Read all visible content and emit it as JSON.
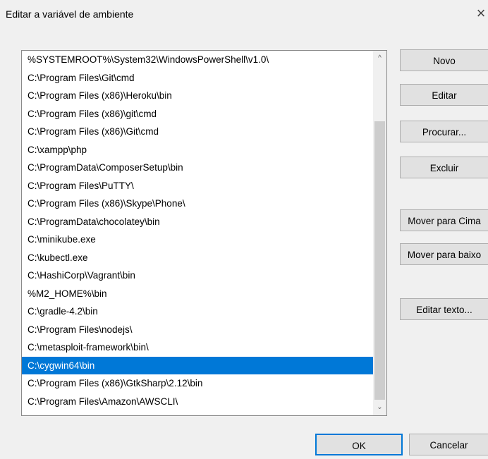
{
  "dialog": {
    "title": "Editar a variável de ambiente",
    "close_glyph": "×"
  },
  "path_list": {
    "selected_index": 18,
    "items": [
      "%SYSTEMROOT%\\System32\\WindowsPowerShell\\v1.0\\",
      "C:\\Program Files\\Git\\cmd",
      "C:\\Program Files (x86)\\Heroku\\bin",
      "C:\\Program Files (x86)\\git\\cmd",
      "C:\\Program Files (x86)\\Git\\cmd",
      "C:\\xampp\\php",
      "C:\\ProgramData\\ComposerSetup\\bin",
      "C:\\Program Files\\PuTTY\\",
      "C:\\Program Files (x86)\\Skype\\Phone\\",
      "C:\\ProgramData\\chocolatey\\bin",
      "C:\\minikube.exe",
      "C:\\kubectl.exe",
      "C:\\HashiCorp\\Vagrant\\bin",
      "%M2_HOME%\\bin",
      "C:\\gradle-4.2\\bin",
      "C:\\Program Files\\nodejs\\",
      "C:\\metasploit-framework\\bin\\",
      "C:\\cygwin64\\bin",
      "C:\\Program Files (x86)\\GtkSharp\\2.12\\bin",
      "C:\\Program Files\\Amazon\\AWSCLI\\"
    ]
  },
  "scrollbar": {
    "up_glyph": "^",
    "down_glyph": "⌄"
  },
  "buttons": {
    "novo": "Novo",
    "editar": "Editar",
    "procurar": "Procurar...",
    "excluir": "Excluir",
    "mover_cima": "Mover para Cima",
    "mover_baixo": "Mover para baixo",
    "editar_texto": "Editar texto...",
    "ok": "OK",
    "cancelar": "Cancelar"
  },
  "colors": {
    "selection": "#0078d7",
    "background": "#f0f0f0",
    "button_face": "#e1e1e1"
  }
}
